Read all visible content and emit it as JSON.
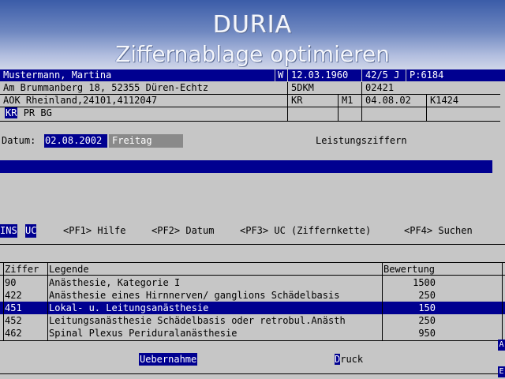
{
  "app": {
    "title_line1": "DURIA",
    "title_line2": "Ziffernablage optimieren"
  },
  "patient": {
    "name": "Mustermann, Martina",
    "sex": "W",
    "birthdate": "12.03.1960",
    "age": "42/5 J",
    "pnum": "P:6184",
    "address": "Am Brummanberg 18, 52355 Düren-Echtz",
    "code1": "5DKM",
    "code2": "02421",
    "insurance": "AOK Rheinland,24101,4112047",
    "status": "KR",
    "m": "M1",
    "valid": "04.08.02",
    "code3": "K1424",
    "tags": [
      "KR",
      "PR",
      "BG"
    ]
  },
  "dateline": {
    "label": "Datum:",
    "date": "02.08.2002",
    "weekday": "Freitag",
    "section": "Leistungsziffern"
  },
  "keys": {
    "mode1": "INS",
    "mode2": "UC",
    "items": [
      "<PF1> Hilfe",
      "<PF2> Datum",
      "<PF3> UC (Ziffernkette)",
      "<PF4> Suchen"
    ]
  },
  "table": {
    "headers": [
      "Ziffer",
      "Legende",
      "Bewertung"
    ],
    "rows": [
      {
        "ziffer": "90",
        "legende": "Anästhesie, Kategorie I",
        "bewertung": "1500"
      },
      {
        "ziffer": "422",
        "legende": "Anästhesie eines Hirnnerven/ ganglions Schädelbasis",
        "bewertung": "250"
      },
      {
        "ziffer": "451",
        "legende": "Lokal- u. Leitungsanästhesie",
        "bewertung": "150"
      },
      {
        "ziffer": "452",
        "legende": "Leitungsanästhesie Schädelbasis oder retrobul.Anästh",
        "bewertung": "250"
      },
      {
        "ziffer": "462",
        "legende": "Spinal  Plexus  Periduralanästhesie",
        "bewertung": "950"
      }
    ],
    "selected_index": 2,
    "side_top": "A",
    "side_bottom": "E"
  },
  "buttons": {
    "accept": "Uebernahme",
    "print_hot": "D",
    "print_rest": "ruck"
  },
  "colors": {
    "highlight": "#000090",
    "background": "#c6c6c6"
  }
}
